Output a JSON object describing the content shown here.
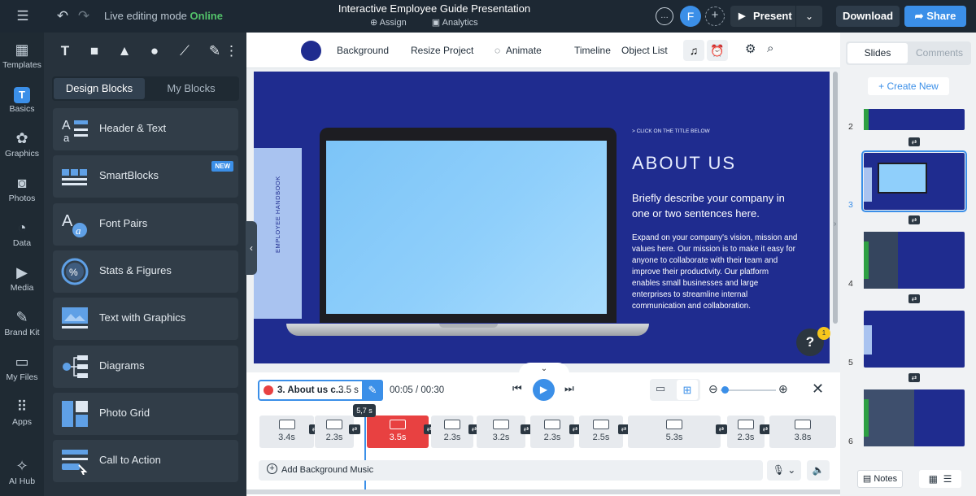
{
  "topbar": {
    "live_prefix": "Live editing mode",
    "live_status": "Online",
    "title": "Interactive Employee Guide Presentation",
    "assign": "Assign",
    "analytics": "Analytics",
    "avatar_letter": "F",
    "present": "Present",
    "download": "Download",
    "share": "Share"
  },
  "rail": [
    {
      "label": "Templates",
      "icon": "templates-icon"
    },
    {
      "label": "Basics",
      "icon": "basics-icon"
    },
    {
      "label": "Graphics",
      "icon": "graphics-icon"
    },
    {
      "label": "Photos",
      "icon": "photos-icon"
    },
    {
      "label": "Data",
      "icon": "data-icon"
    },
    {
      "label": "Media",
      "icon": "media-icon"
    },
    {
      "label": "Brand Kit",
      "icon": "brand-kit-icon"
    },
    {
      "label": "My Files",
      "icon": "folder-icon"
    },
    {
      "label": "Apps",
      "icon": "apps-icon"
    },
    {
      "label": "AI Hub",
      "icon": "ai-hub-icon"
    }
  ],
  "panel": {
    "tab_design": "Design Blocks",
    "tab_my": "My Blocks",
    "new_badge": "NEW",
    "blocks": [
      "Header & Text",
      "SmartBlocks",
      "Font Pairs",
      "Stats & Figures",
      "Text with Graphics",
      "Diagrams",
      "Photo Grid",
      "Call to Action"
    ]
  },
  "toolbar": {
    "background": "Background",
    "resize": "Resize Project",
    "animate": "Animate",
    "timeline": "Timeline",
    "object_list": "Object List",
    "swatch_color": "#1f2c8f"
  },
  "slide": {
    "tab_text": "EMPLOYEE HANDBOOK",
    "kicker": "> CLICK ON THE  TITLE BELOW",
    "heading": "ABOUT US",
    "subheading": "Briefly describe your company in one or two sentences here.",
    "body": "Expand on your company's vision, mission and values here. Our mission is to make it easy for anyone to collaborate with their team and improve their productivity. Our platform enables small businesses and large enterprises to streamline internal communication and collaboration.",
    "help": "?",
    "help_badge": "1"
  },
  "timeline": {
    "clip_name": "3. About us c...",
    "clip_duration": "3.5 s",
    "time": "00:05 / 00:30",
    "playhead_label": "5,7 s",
    "tracks": [
      "3.4s",
      "2.3s",
      "3.5s",
      "2.3s",
      "3.2s",
      "2.3s",
      "2.5s",
      "5.3s",
      "2.3s",
      "3.8s"
    ],
    "selected_track": 2,
    "music_label": "Add Background Music"
  },
  "right": {
    "tab_slides": "Slides",
    "tab_comments": "Comments",
    "create_new": "+ Create New",
    "slide_numbers": [
      "2",
      "3",
      "4",
      "5",
      "6"
    ],
    "selected_slide": "3",
    "notes": "Notes"
  }
}
